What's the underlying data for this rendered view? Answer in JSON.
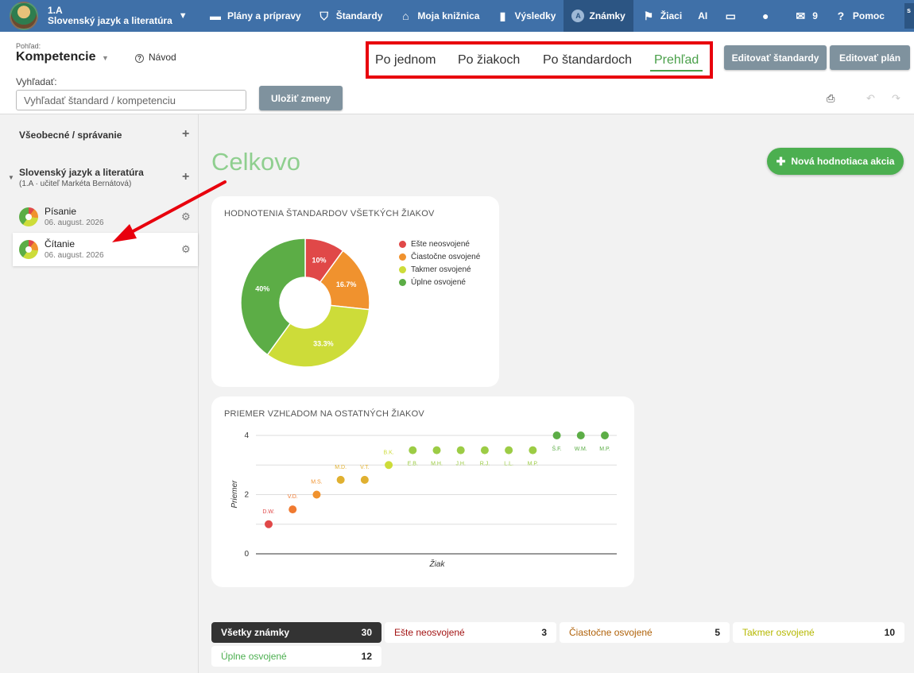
{
  "colors": {
    "topbar": "#3f70a8",
    "not_mastered": "#e04848",
    "partial": "#f0922e",
    "almost": "#cddc39",
    "mastered": "#5cad46",
    "accent_green": "#4caf50",
    "highlight_red": "#e8000d"
  },
  "brand": {
    "class": "1.A",
    "subject": "Slovenský jazyk a literatúra"
  },
  "nav": {
    "items": [
      {
        "label": "Plány a prípravy",
        "icon": "briefcase-icon"
      },
      {
        "label": "Štandardy",
        "icon": "shield-check-icon"
      },
      {
        "label": "Moja knižnica",
        "icon": "library-icon"
      },
      {
        "label": "Výsledky",
        "icon": "bar-chart-icon"
      },
      {
        "label": "Známky",
        "icon": "grades-icon"
      },
      {
        "label": "Žiaci",
        "icon": "students-icon"
      },
      {
        "label": "AI",
        "icon": ""
      },
      {
        "label": "",
        "icon": "cast-icon"
      },
      {
        "label": "",
        "icon": "chat-icon"
      },
      {
        "label": "9",
        "icon": "mail-icon"
      },
      {
        "label": "Pomoc",
        "icon": "help-icon"
      }
    ],
    "user_initial": "s"
  },
  "view": {
    "label": "Pohľad:",
    "value": "Kompetencie",
    "help": "Návod"
  },
  "search": {
    "label": "Vyhľadať:",
    "placeholder": "Vyhľadať štandard / kompetenciu"
  },
  "save_button": "Uložiť zmeny",
  "tabs": [
    "Po jednom",
    "Po žiakoch",
    "Po štandardoch",
    "Prehľad"
  ],
  "edit_standards_button": "Editovať štandardy",
  "edit_plan_button": "Editovať plán",
  "sidebar": {
    "general": "Všeobecné / správanie",
    "subject": "Slovenský jazyk a literatúra",
    "subject_meta": "(1.A · učiteľ Markéta Bernátová)",
    "items": [
      {
        "name": "Písanie",
        "date": "06. august. 2026"
      },
      {
        "name": "Čítanie",
        "date": "06. august. 2026"
      }
    ]
  },
  "main": {
    "title": "Celkovo",
    "new_action_button": "Nová hodnotiaca akcia"
  },
  "chart_data": [
    {
      "type": "pie",
      "title": "HODNOTENIA ŠTANDARDOV VŠETKÝCH ŽIAKOV",
      "categories": [
        "Ešte neosvojené",
        "Čiastočne osvojené",
        "Takmer osvojené",
        "Úplne osvojené"
      ],
      "values": [
        10,
        16.7,
        33.3,
        40
      ],
      "labels": [
        "10%",
        "16.7%",
        "33.3%",
        "40%"
      ],
      "colors": [
        "#e04848",
        "#f0922e",
        "#cddc39",
        "#5cad46"
      ],
      "legend": "right"
    },
    {
      "type": "scatter",
      "title": "PRIEMER VZHĽADOM NA OSTATNÝCH ŽIAKOV",
      "xlabel": "Žiak",
      "ylabel": "Priemer",
      "ylim": [
        0,
        4
      ],
      "yticks": [
        0,
        2,
        4
      ],
      "grid": true,
      "points": [
        {
          "label": "D.W.",
          "y": 1.0,
          "color": "#e04848"
        },
        {
          "label": "V.D.",
          "y": 1.5,
          "color": "#f07a30"
        },
        {
          "label": "M.S.",
          "y": 2.0,
          "color": "#f0922e"
        },
        {
          "label": "M.D.",
          "y": 2.5,
          "color": "#e0b030"
        },
        {
          "label": "V.T.",
          "y": 2.5,
          "color": "#e0b030"
        },
        {
          "label": "B.K.",
          "y": 3.0,
          "color": "#cddc39"
        },
        {
          "label": "E.B.",
          "y": 3.5,
          "color": "#9ccc45"
        },
        {
          "label": "M.H.",
          "y": 3.5,
          "color": "#9ccc45"
        },
        {
          "label": "J.H.",
          "y": 3.5,
          "color": "#9ccc45"
        },
        {
          "label": "R.J.",
          "y": 3.5,
          "color": "#9ccc45"
        },
        {
          "label": "L.L.",
          "y": 3.5,
          "color": "#9ccc45"
        },
        {
          "label": "M.P.",
          "y": 3.5,
          "color": "#9ccc45"
        },
        {
          "label": "Š.F.",
          "y": 4.0,
          "color": "#5cad46"
        },
        {
          "label": "W.M.",
          "y": 4.0,
          "color": "#5cad46"
        },
        {
          "label": "M.P.",
          "y": 4.0,
          "color": "#5cad46"
        }
      ]
    }
  ],
  "filters": [
    {
      "label": "Všetky známky",
      "count": "30",
      "color": "#ffffff"
    },
    {
      "label": "Ešte neosvojené",
      "count": "3",
      "color": "#a31515"
    },
    {
      "label": "Čiastočne osvojené",
      "count": "5",
      "color": "#b0620a"
    },
    {
      "label": "Takmer osvojené",
      "count": "10",
      "color": "#b5b800"
    },
    {
      "label": "Úplne osvojené",
      "count": "12",
      "color": "#4caf50"
    }
  ]
}
